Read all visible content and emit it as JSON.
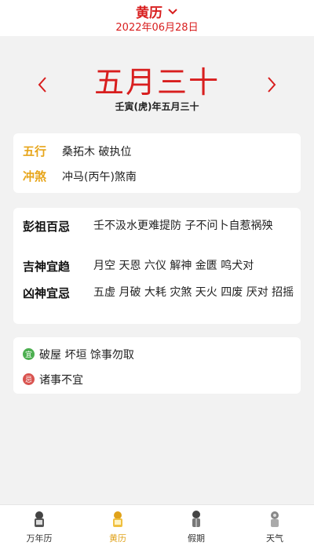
{
  "header": {
    "title": "黄历",
    "date": "2022年06月28日"
  },
  "lunar": {
    "big": "五月三十",
    "sub": "壬寅(虎)年五月三十"
  },
  "wuxing": {
    "label": "五行",
    "value": "桑拓木 破执位"
  },
  "chongsha": {
    "label": "冲煞",
    "value": "冲马(丙午)煞南"
  },
  "pengzu": {
    "label": "彭祖百忌",
    "value": "壬不汲水更难提防 子不问卜自惹祸殃"
  },
  "jishen": {
    "label": "吉神宜趋",
    "value": "月空 天恩 六仪 解神 金匮 鸣犬对"
  },
  "xiongshen": {
    "label": "凶神宜忌",
    "value": "五虚 月破 大耗 灾煞 天火 四废 厌对 招摇"
  },
  "yi": {
    "badge": "宜",
    "value": "破屋 坏垣 馀事勿取",
    "color": "#4caf50"
  },
  "ji": {
    "badge": "忌",
    "value": "诸事不宜",
    "color": "#d9534f"
  },
  "tabs": [
    {
      "label": "万年历",
      "icon": "calendar-icon"
    },
    {
      "label": "黄历",
      "icon": "almanac-icon"
    },
    {
      "label": "假期",
      "icon": "holiday-icon"
    },
    {
      "label": "天气",
      "icon": "weather-icon"
    }
  ],
  "colors": {
    "accent": "#d81e1e",
    "gold": "#e7a51a"
  }
}
